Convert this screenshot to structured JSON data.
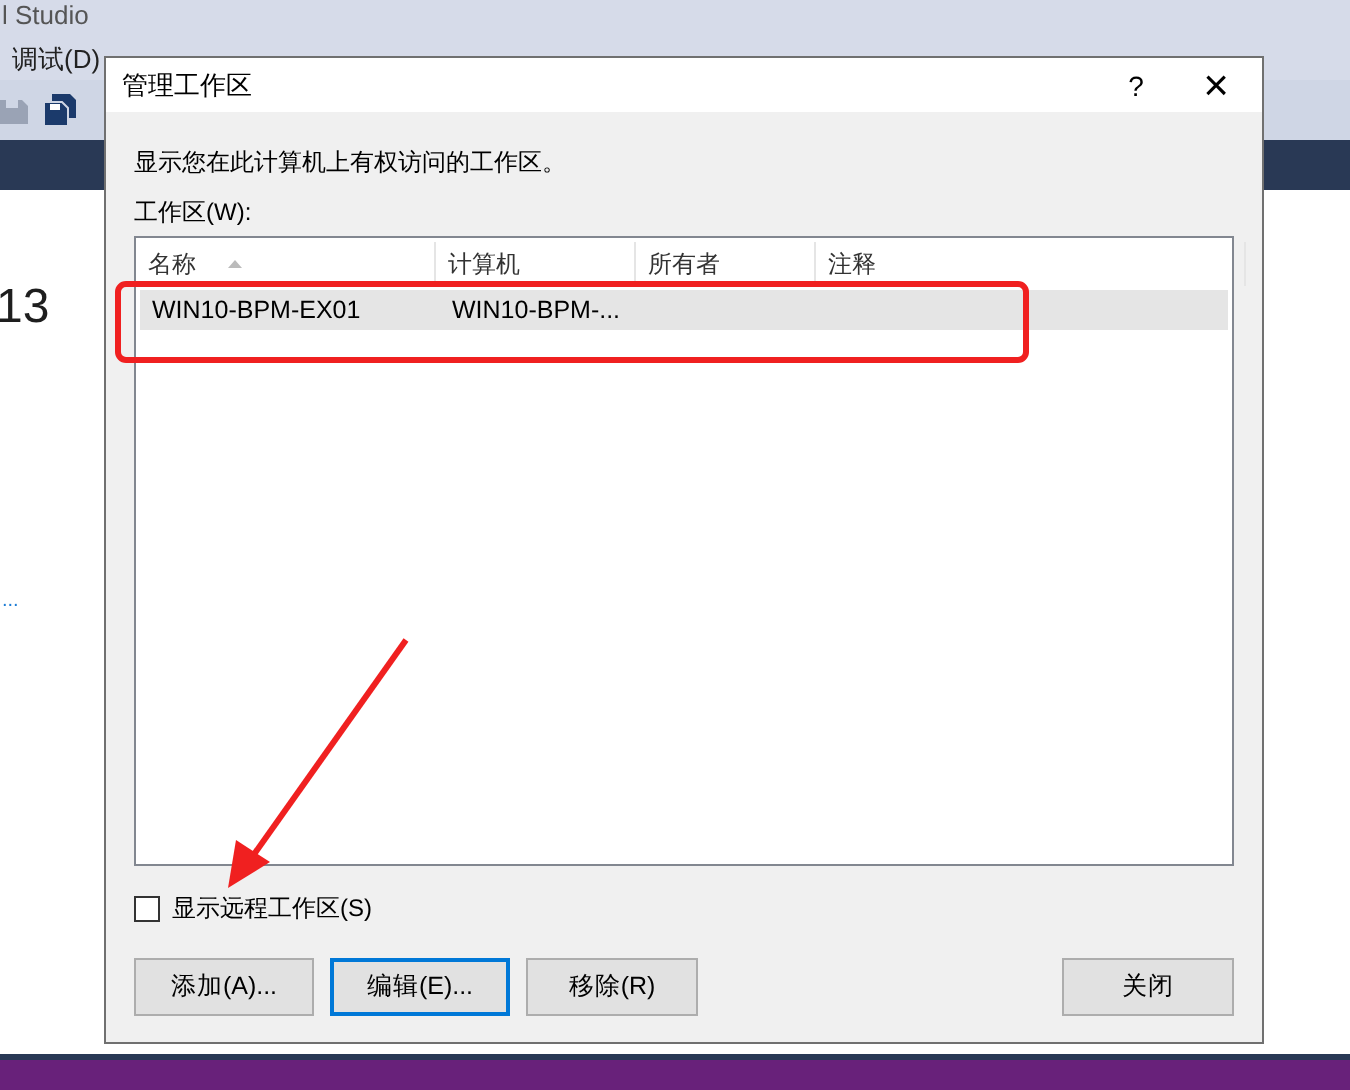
{
  "app": {
    "title": "l Studio",
    "menu": [
      "调试(D)"
    ],
    "start_page_number": "13",
    "start_page_link": "..."
  },
  "dialog": {
    "title": "管理工作区",
    "help": "?",
    "close": "×",
    "description": "显示您在此计算机上有权访问的工作区。",
    "list_label": "工作区(W):",
    "columns": [
      {
        "label": "名称",
        "sorted": true
      },
      {
        "label": "计算机",
        "sorted": false
      },
      {
        "label": "所有者",
        "sorted": false
      },
      {
        "label": "注释",
        "sorted": false
      }
    ],
    "rows": [
      {
        "cells": [
          "WIN10-BPM-EX01",
          "WIN10-BPM-..."
        ],
        "selected": true
      }
    ],
    "show_remote": {
      "label": "显示远程工作区(S)",
      "checked": false
    },
    "buttons": [
      {
        "label": "添加(A)...",
        "focused": false
      },
      {
        "label": "编辑(E)...",
        "focused": true
      },
      {
        "label": "移除(R)",
        "focused": false
      },
      {
        "label": "关闭",
        "focused": false
      }
    ]
  }
}
